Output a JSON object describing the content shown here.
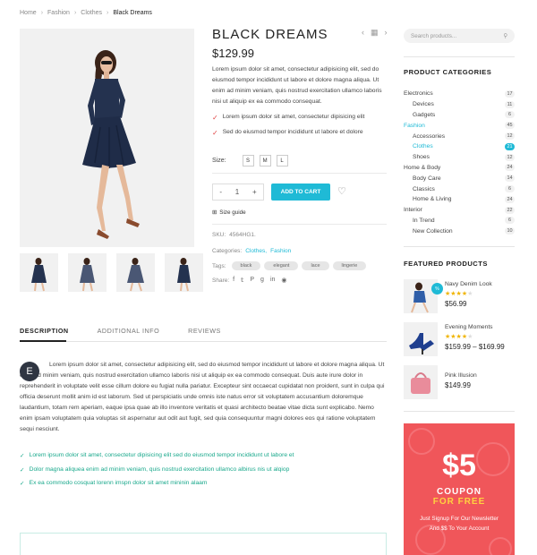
{
  "breadcrumb": {
    "home": "Home",
    "fashion": "Fashion",
    "clothes": "Clothes",
    "current": "Black Dreams",
    "sep": "›"
  },
  "product": {
    "title": "BLACK DREAMS",
    "price": "$129.99",
    "description": "Lorem ipsum dolor sit amet, consectetur adipisicing elit, sed do eiusmod tempor incididunt ut labore et dolore magna aliqua. Ut enim ad minim veniam, quis nostrud exercitation ullamco laboris nisi ut aliquip ex ea commodo consequat.",
    "features": [
      "Lorem ipsum dolor sit amet, consectetur dipisicing elit",
      "Sed do eiusmod tempor incididunt ut labore et dolore"
    ],
    "size_label": "Size:",
    "sizes": [
      "S",
      "M",
      "L"
    ],
    "qty_minus": "-",
    "qty_value": "1",
    "qty_plus": "+",
    "add_to_cart": "ADD TO CART",
    "size_guide": "Size guide",
    "sku_label": "SKU:",
    "sku": "4564HG1.",
    "categories_label": "Categories:",
    "category_1": "Clothes,",
    "category_2": "Fashion",
    "tags_label": "Tags:",
    "tags": [
      "black",
      "elegant",
      "lace",
      "lingerie"
    ],
    "share_label": "Share:"
  },
  "tabs": {
    "description": "DESCRIPTION",
    "additional": "ADDITIONAL INFO",
    "reviews": "REVIEWS"
  },
  "content": {
    "dropcap": "E",
    "long_text": "Lorem ipsum dolor sit amet, consectetur adipisicing elit, sed do eiusmod tempor incididunt ut labore et dolore magna aliqua. Ut enim ad minim veniam, quis nostrud exercitation ullamco laboris nisi ut aliquip ex ea commodo consequat. Duis aute irure dolor in reprehenderit in voluptate velit esse cillum dolore eu fugiat nulla pariatur. Excepteur sint occaecat cupidatat non proident, sunt in culpa qui officia deserunt mollit anim id est laborum. Sed ut perspiciatis unde omnis iste natus error sit voluptatem accusantium doloremque laudantium, totam rem aperiam, eaque ipsa quae ab illo inventore veritatis et quasi architecto beatae vitae dicta sunt explicabo. Nemo enim ipsam voluptatem quia voluptas sit aspernatur aut odit aut fugit, sed quia consequuntur magni dolores eos qui ratione voluptatem sequi nesciunt.",
    "checks": [
      "Lorem ipsum dolor sit amet, consectetur dipisicing elit sed do eiusmod tempor incididunt ut labore et",
      "Dolor magna aliquea enim ad minim veniam, quis nostrud exercitation ullamco albirus nis ut alqiop",
      "Ex ea commodo cosquat lorenn imspn dolor sit amet mininin alaam"
    ]
  },
  "sidebar": {
    "search_placeholder": "Search products...",
    "categories_title": "PRODUCT CATEGORIES",
    "categories": [
      {
        "name": "Electronics",
        "count": "17",
        "child": false
      },
      {
        "name": "Devices",
        "count": "11",
        "child": true
      },
      {
        "name": "Gadgets",
        "count": "6",
        "child": true
      },
      {
        "name": "Fashion",
        "count": "45",
        "child": false,
        "active": true
      },
      {
        "name": "Accessories",
        "count": "12",
        "child": true
      },
      {
        "name": "Clothes",
        "count": "21",
        "child": true,
        "active": true,
        "highlight": true
      },
      {
        "name": "Shoes",
        "count": "12",
        "child": true
      },
      {
        "name": "Home & Body",
        "count": "24",
        "child": false
      },
      {
        "name": "Body Care",
        "count": "14",
        "child": true
      },
      {
        "name": "Classics",
        "count": "6",
        "child": true
      },
      {
        "name": "Home & Living",
        "count": "24",
        "child": true
      },
      {
        "name": "Interior",
        "count": "22",
        "child": false
      },
      {
        "name": "In Trend",
        "count": "6",
        "child": true
      },
      {
        "name": "New Collection",
        "count": "10",
        "child": true
      }
    ],
    "featured_title": "FEATURED PRODUCTS",
    "featured": [
      {
        "name": "Navy Denim Look",
        "stars": 4,
        "price": "$56.99",
        "badge": "%"
      },
      {
        "name": "Evening Moments",
        "stars": 4,
        "price": "$159.99 – $169.99"
      },
      {
        "name": "Pink Illusion",
        "stars": 0,
        "price": "$149.99"
      }
    ],
    "coupon": {
      "amount": "$5",
      "line1": "COUPON",
      "line2": "FOR FREE",
      "sub": "Just Signup For Our Newsletter And $$ To Your Account"
    }
  },
  "colors": {
    "accent": "#1fbad6",
    "check_red": "#e04545",
    "teal": "#18a88b",
    "coupon_bg": "#f0565a",
    "coupon_yellow": "#ffd23f"
  }
}
